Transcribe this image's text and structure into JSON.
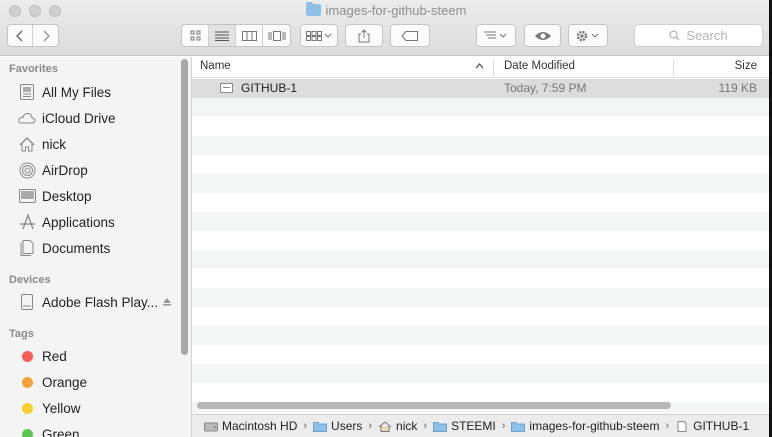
{
  "window": {
    "title": "images-for-github-steem"
  },
  "toolbar": {
    "back_icon": "chevron-left-icon",
    "forward_icon": "chevron-right-icon",
    "search_placeholder": "Search"
  },
  "sidebar": {
    "favorites_header": "Favorites",
    "favorites": [
      {
        "label": "All My Files",
        "icon": "all-files-icon"
      },
      {
        "label": "iCloud Drive",
        "icon": "cloud-icon"
      },
      {
        "label": "nick",
        "icon": "home-icon"
      },
      {
        "label": "AirDrop",
        "icon": "airdrop-icon"
      },
      {
        "label": "Desktop",
        "icon": "desktop-icon"
      },
      {
        "label": "Applications",
        "icon": "applications-icon"
      },
      {
        "label": "Documents",
        "icon": "documents-icon"
      }
    ],
    "devices_header": "Devices",
    "devices": [
      {
        "label": "Adobe Flash Play...",
        "icon": "disk-icon"
      }
    ],
    "tags_header": "Tags",
    "tags": [
      {
        "label": "Red",
        "color": "#fc5b57"
      },
      {
        "label": "Orange",
        "color": "#f5a03a"
      },
      {
        "label": "Yellow",
        "color": "#f7cf2f"
      },
      {
        "label": "Green",
        "color": "#5fc552"
      }
    ]
  },
  "list": {
    "columns": {
      "name": "Name",
      "date": "Date Modified",
      "size": "Size"
    },
    "rows": [
      {
        "name": "GITHUB-1",
        "date": "Today, 7:59 PM",
        "size": "119 KB"
      }
    ]
  },
  "pathbar": [
    {
      "label": "Macintosh HD",
      "icon": "hard-drive-icon"
    },
    {
      "label": "Users",
      "icon": "folder-icon"
    },
    {
      "label": "nick",
      "icon": "home-icon"
    },
    {
      "label": "STEEMI",
      "icon": "folder-icon"
    },
    {
      "label": "images-for-github-steem",
      "icon": "folder-icon"
    },
    {
      "label": "GITHUB-1",
      "icon": "file-icon"
    }
  ]
}
